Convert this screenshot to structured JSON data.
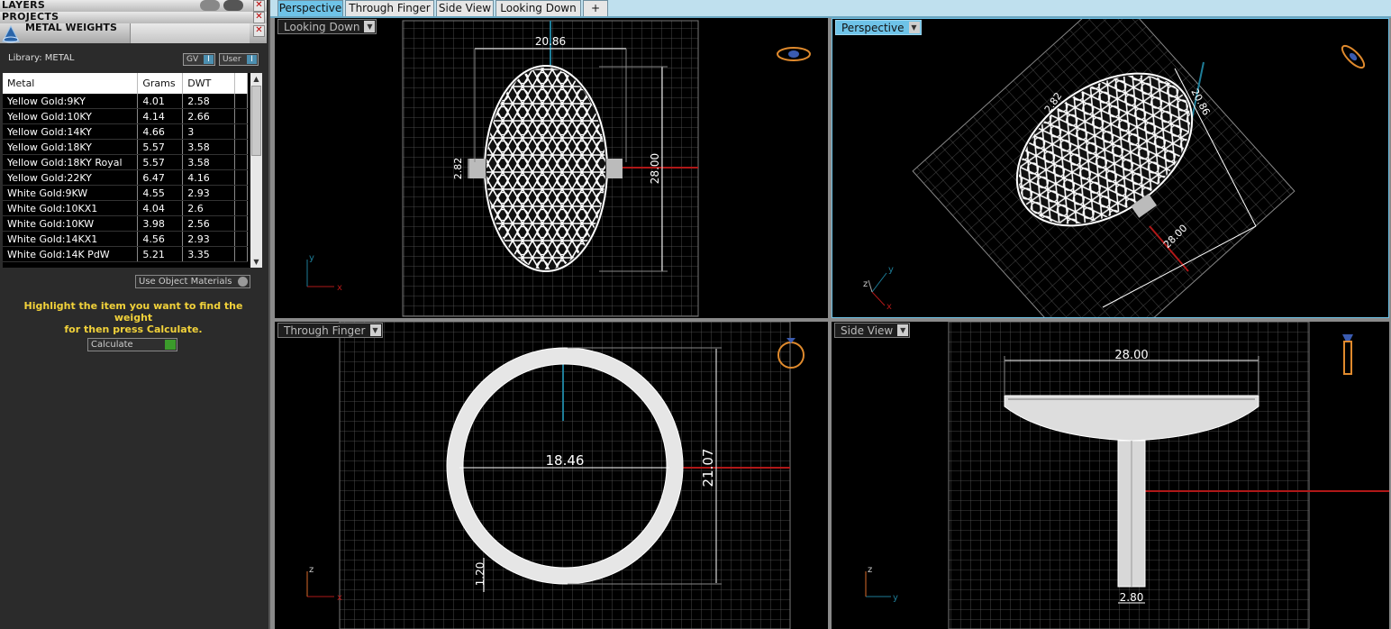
{
  "left_panel": {
    "layers_label": "LAYERS",
    "projects_label": "PROJECTS",
    "metal_weights_title": "METAL WEIGHTS",
    "library_label": "Library: METAL",
    "gv_label": "GV",
    "user_label": "User",
    "gv_badge": "I",
    "table": {
      "headers": [
        "Metal",
        "Grams",
        "DWT"
      ],
      "rows": [
        [
          "Yellow Gold:9KY",
          "4.01",
          "2.58"
        ],
        [
          "Yellow Gold:10KY",
          "4.14",
          "2.66"
        ],
        [
          "Yellow Gold:14KY",
          "4.66",
          "3"
        ],
        [
          "Yellow Gold:18KY",
          "5.57",
          "3.58"
        ],
        [
          "Yellow Gold:18KY Royal",
          "5.57",
          "3.58"
        ],
        [
          "Yellow Gold:22KY",
          "6.47",
          "4.16"
        ],
        [
          "White Gold:9KW",
          "4.55",
          "2.93"
        ],
        [
          "White Gold:10KX1",
          "4.04",
          "2.6"
        ],
        [
          "White Gold:10KW",
          "3.98",
          "2.56"
        ],
        [
          "White Gold:14KX1",
          "4.56",
          "2.93"
        ],
        [
          "White Gold:14K PdW",
          "5.21",
          "3.35"
        ]
      ]
    },
    "use_object_materials": "Use Object Materials",
    "hint_line1": "Highlight the item you want to find the weight",
    "hint_line2": "for then press Calculate.",
    "calculate_label": "Calculate"
  },
  "tabs": [
    "Perspective",
    "Through Finger",
    "Side View",
    "Looking Down",
    "+"
  ],
  "viewports": {
    "looking_down": {
      "label": "Looking Down",
      "dim_width": "20.86",
      "dim_height": "28.00",
      "dim_shank": "2.82"
    },
    "perspective": {
      "label": "Perspective",
      "dim_width": "20.86",
      "dim_height": "28.00",
      "dim_shank": "2.82"
    },
    "through_finger": {
      "label": "Through Finger",
      "dim_inner": "18.46",
      "dim_outer": "21.07",
      "dim_thick": "1.20"
    },
    "side_view": {
      "label": "Side View",
      "dim_width": "28.00",
      "dim_shank": "2.80"
    }
  },
  "axis": {
    "x": "x",
    "y": "y",
    "z": "z"
  },
  "colors": {
    "accent_tab": "#6ec3e8",
    "dim_text": "#ffffff",
    "hint": "#f2d23a",
    "axis_x": "#b01818",
    "axis_y": "#1e7d98"
  }
}
